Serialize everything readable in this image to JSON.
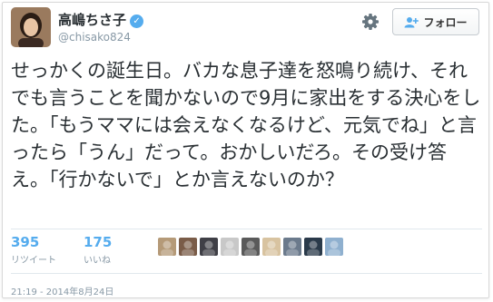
{
  "user": {
    "name": "高嶋ちさ子",
    "handle": "@chisako824",
    "verified_glyph": "✓"
  },
  "follow_button": {
    "label": "フォロー"
  },
  "tweet": {
    "text": "せっかくの誕生日。バカな息子達を怒鳴り続け、それでも言うことを聞かないので9月に家出をする決心をした。「もうママには会えなくなるけど、元気でね」と言ったら「うん」だって。おかしいだろ。その受け答え。「行かないで」とか言えないのか？"
  },
  "stats": {
    "retweets": {
      "count": "395",
      "label": "リツイート"
    },
    "likes": {
      "count": "175",
      "label": "いいね"
    }
  },
  "likers": [
    {
      "color": "#b59a78"
    },
    {
      "color": "#7a5c48"
    },
    {
      "color": "#3f3f46"
    },
    {
      "color": "#c8c8c8"
    },
    {
      "color": "#5a5a5a"
    },
    {
      "color": "#d8c3a0"
    },
    {
      "color": "#6b7a8c"
    },
    {
      "color": "#2a3a4a"
    },
    {
      "color": "#8fb0cf"
    }
  ],
  "timestamp": "21:19 - 2014年8月24日",
  "colors": {
    "accent": "#55acee",
    "text": "#292f33",
    "muted": "#8899a6"
  }
}
